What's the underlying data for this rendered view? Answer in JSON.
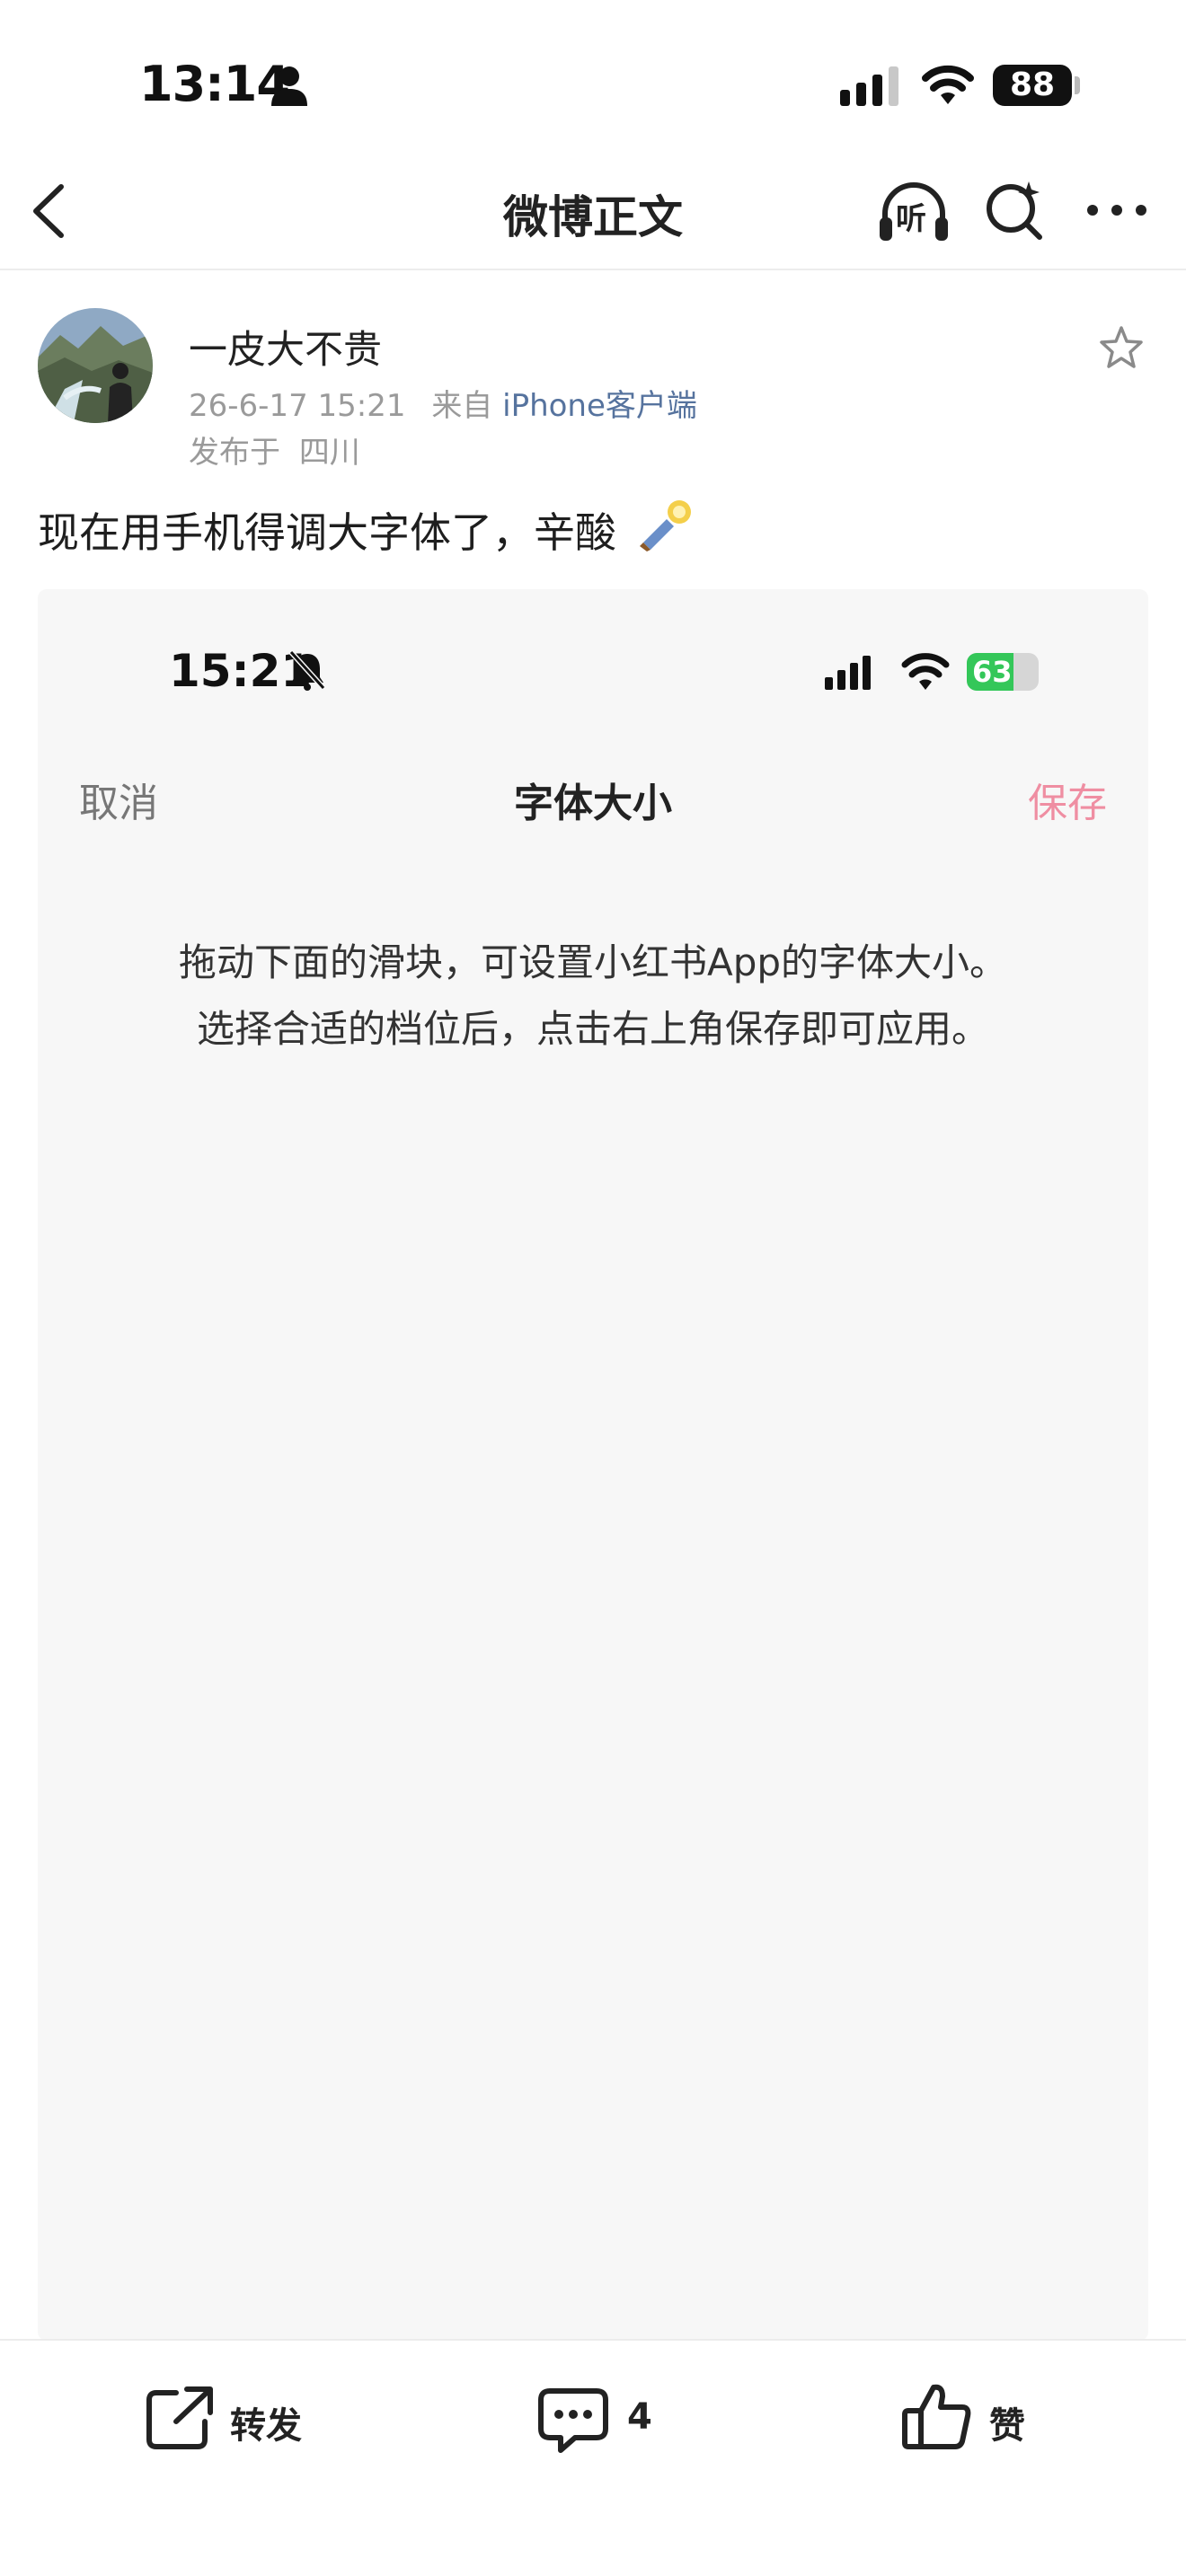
{
  "status_bar": {
    "time": "13:14",
    "battery": "88"
  },
  "nav": {
    "title": "微博正文",
    "listen_label": "听"
  },
  "post": {
    "username": "一皮大不贵",
    "timestamp": "26-6-17 15:21",
    "source_prefix": "来自",
    "source_client": "iPhone客户端",
    "location_prefix": "发布于",
    "location": "四川",
    "text": "现在用手机得调大字体了，辛酸",
    "emoji": "🕯"
  },
  "embedded_screenshot": {
    "status_time": "15:21",
    "battery": "63",
    "cancel_label": "取消",
    "title": "字体大小",
    "save_label": "保存",
    "description_line1": "拖动下面的滑块，可设置小红书App的字体大小。",
    "description_line2": "选择合适的档位后，点击右上角保存即可应用。"
  },
  "actions": {
    "repost_label": "转发",
    "comment_count": "4",
    "like_label": "赞"
  },
  "colors": {
    "accent_link": "#56739e",
    "save_pink": "#ef8ea2",
    "battery_green": "#34c759"
  }
}
